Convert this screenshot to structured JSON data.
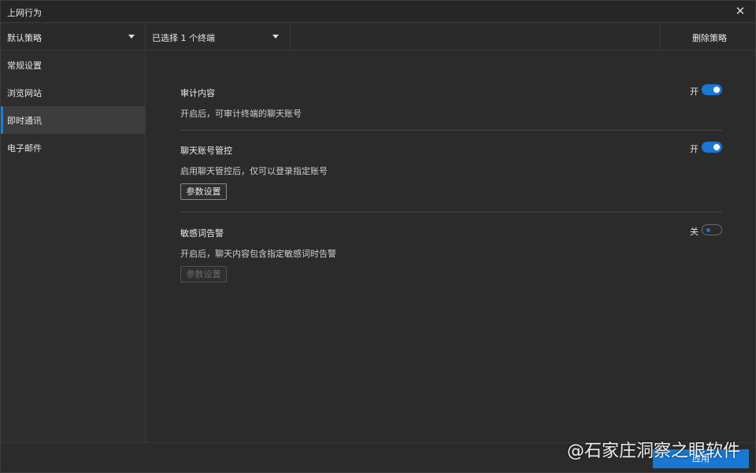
{
  "window": {
    "title": "上网行为",
    "close_icon": "close-icon"
  },
  "toolbar": {
    "policy_dropdown": "默认策略",
    "terminal_dropdown": "已选择 1 个终端",
    "delete_policy": "删除策略"
  },
  "sidebar": {
    "items": [
      {
        "label": "常规设置",
        "active": false
      },
      {
        "label": "浏览网站",
        "active": false
      },
      {
        "label": "即时通讯",
        "active": true
      },
      {
        "label": "电子邮件",
        "active": false
      }
    ]
  },
  "sections": [
    {
      "title": "审计内容",
      "toggle_label": "开",
      "toggle_on": true,
      "desc": "开启后，可审计终端的聊天账号"
    },
    {
      "title": "聊天账号管控",
      "toggle_label": "开",
      "toggle_on": true,
      "desc": "启用聊天管控后，仅可以登录指定账号",
      "button": "参数设置",
      "button_enabled": true
    },
    {
      "title": "敏感词告警",
      "toggle_label": "关",
      "toggle_on": false,
      "desc": "开启后，聊天内容包含指定敏感词时告警",
      "button": "参数设置",
      "button_enabled": false
    }
  ],
  "footer": {
    "apply": "应用"
  },
  "watermark": "@石家庄洞察之眼软件",
  "colors": {
    "accent": "#1a78d2",
    "background": "#2b2b2b"
  }
}
